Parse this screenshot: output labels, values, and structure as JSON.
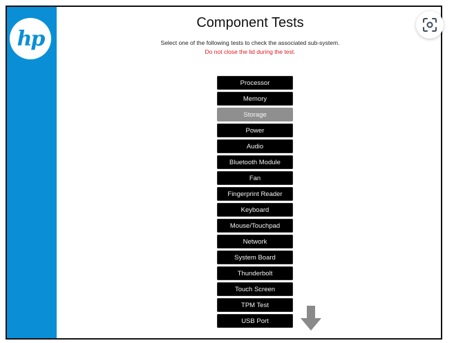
{
  "brand": {
    "logo_text": "hp",
    "sidebar_color": "#0a8fd6"
  },
  "header": {
    "title": "Component Tests",
    "subtitle": "Select one of the following tests to check the associated sub-system.",
    "warning": "Do not close the lid during the test.",
    "warning_color": "#e0181b"
  },
  "tests": [
    {
      "label": "Processor",
      "selected": false
    },
    {
      "label": "Memory",
      "selected": false
    },
    {
      "label": "Storage",
      "selected": true
    },
    {
      "label": "Power",
      "selected": false
    },
    {
      "label": "Audio",
      "selected": false
    },
    {
      "label": "Bluetooth Module",
      "selected": false
    },
    {
      "label": "Fan",
      "selected": false
    },
    {
      "label": "Fingerprint Reader",
      "selected": false
    },
    {
      "label": "Keyboard",
      "selected": false
    },
    {
      "label": "Mouse/Touchpad",
      "selected": false
    },
    {
      "label": "Network",
      "selected": false
    },
    {
      "label": "System Board",
      "selected": false
    },
    {
      "label": "Thunderbolt",
      "selected": false
    },
    {
      "label": "Touch Screen",
      "selected": false
    },
    {
      "label": "TPM Test",
      "selected": false
    },
    {
      "label": "USB Port",
      "selected": false
    }
  ],
  "icons": {
    "scroll_down": "arrow-down-icon",
    "visual_search": "lens-icon"
  }
}
